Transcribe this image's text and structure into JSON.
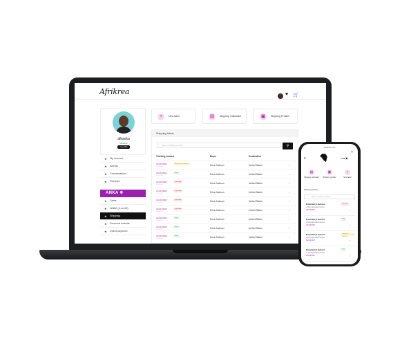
{
  "laptop": {
    "logo": "Afrikrea",
    "header_icons": {
      "heart": "heart-icon",
      "cart": "cart-icon"
    },
    "profile": {
      "name": "afkanka",
      "status": "Muakhar",
      "button": "my profile"
    },
    "menu": [
      {
        "label": "My account"
      },
      {
        "label": "Activity"
      },
      {
        "label": "Conversations"
      },
      {
        "label": "Reviews"
      }
    ],
    "brand": "ANKA ✵",
    "menu2": [
      {
        "label": "Sales"
      },
      {
        "label": "Wallet (e-credit)"
      },
      {
        "label": "Shipping",
        "active": true
      },
      {
        "label": "Personal website"
      },
      {
        "label": "Direct payment"
      }
    ],
    "cards": [
      {
        "label": "New label",
        "icon": "plus-icon",
        "glyph": "+"
      },
      {
        "label": "Shipping Calculator",
        "icon": "calculator-icon",
        "glyph": "▤"
      },
      {
        "label": "Shipping Profiles",
        "icon": "profiles-icon",
        "glyph": "▣"
      }
    ],
    "panel": {
      "title": "Shipping labels",
      "search_placeholder": "Buyer, tracking number...",
      "columns": [
        "Tracking number",
        "Buyer",
        "Destination"
      ],
      "rows": [
        {
          "tracking": "AK12345ET",
          "date": "12.4.2019",
          "badge": "Waiting for shipment",
          "badge_color": "yellow",
          "buyer": "Erica Jackson",
          "destination": "United States"
        },
        {
          "tracking": "AK12345ET",
          "date": "12.4.2019",
          "badge": "Sent",
          "badge_color": "green",
          "buyer": "Erica Jackson",
          "destination": "United States"
        },
        {
          "tracking": "AK12345ET",
          "date": "12.4.2019",
          "badge": "Canceled",
          "badge_color": "red",
          "buyer": "Erica Jackson",
          "destination": "United States"
        },
        {
          "tracking": "AK12345ET",
          "date": "12.4.2019",
          "badge": "Canceled",
          "badge_color": "red",
          "buyer": "Erica Jackson",
          "destination": "United States"
        },
        {
          "tracking": "AK12345ET",
          "date": "12.4.2019",
          "badge": "Canceled",
          "badge_color": "red",
          "buyer": "Erica Jackson",
          "destination": "United States"
        },
        {
          "tracking": "AK12345ET",
          "date": "12.4.2019",
          "badge": "Canceled",
          "badge_color": "red",
          "buyer": "Erica Jackson",
          "destination": "United States"
        },
        {
          "tracking": "AK12345ET",
          "date": "12.4.2019",
          "badge": "Sent",
          "badge_color": "green",
          "buyer": "Erica Jackson",
          "destination": "United States"
        },
        {
          "tracking": "AK12345ET",
          "date": "12.4.2019",
          "badge": "Sent",
          "badge_color": "green",
          "buyer": "Erica Jackson",
          "destination": "United States"
        },
        {
          "tracking": "AK12345ET",
          "date": "12.4.2019",
          "badge": "Sent",
          "badge_color": "green",
          "buyer": "Erica Jackson",
          "destination": "United States"
        }
      ]
    }
  },
  "phone": {
    "url": "afrikrea.com",
    "actions": [
      {
        "label": "Shipping calculator",
        "glyph": "▤"
      },
      {
        "label": "Shipping profiles",
        "glyph": "▣"
      },
      {
        "label": "New label",
        "glyph": "+"
      }
    ],
    "section": "Shipping labels",
    "search_placeholder": "Buyer, tracking number...",
    "rows": [
      {
        "name": "Erica Berryl Jackson",
        "sub": "Unit¤ed gara¤/Montender",
        "tracking": "AK12345ET",
        "badge": "Canceled",
        "badge_color": "red"
      },
      {
        "name": "Erica Berryl Jackson",
        "sub": "Unit¤ed gara¤/Montender",
        "tracking": "AK12345ET",
        "badge": "Sent",
        "badge_color": "green"
      },
      {
        "name": "Erica Berryl Jackson",
        "sub": "Unit¤ed gara¤/Montender",
        "tracking": "AK12345ET",
        "badge": "Waiting for shipment",
        "badge_color": "yellow"
      },
      {
        "name": "Erica Berryl Jackson",
        "sub": "Unit¤ed gara¤/Montender",
        "tracking": "AK12345ET",
        "badge": "Sent",
        "badge_color": "green"
      }
    ]
  },
  "colors": {
    "accent": "#b31da8",
    "brand": "#9b1fb0",
    "dark": "#111111"
  }
}
